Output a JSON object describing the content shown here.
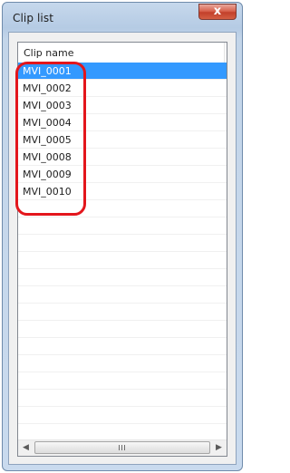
{
  "window": {
    "title": "Clip list",
    "close_glyph": "x"
  },
  "list": {
    "column_header": "Clip name",
    "selected_index": 0,
    "items": [
      "MVI_0001",
      "MVI_0002",
      "MVI_0003",
      "MVI_0004",
      "MVI_0005",
      "MVI_0008",
      "MVI_0009",
      "MVI_0010"
    ]
  },
  "scrollbar": {
    "left_icon": "left-arrow-icon",
    "right_icon": "right-arrow-icon"
  },
  "colors": {
    "selection": "#3399ff",
    "highlight": "#e3161c",
    "close_button": "#c2402b"
  }
}
